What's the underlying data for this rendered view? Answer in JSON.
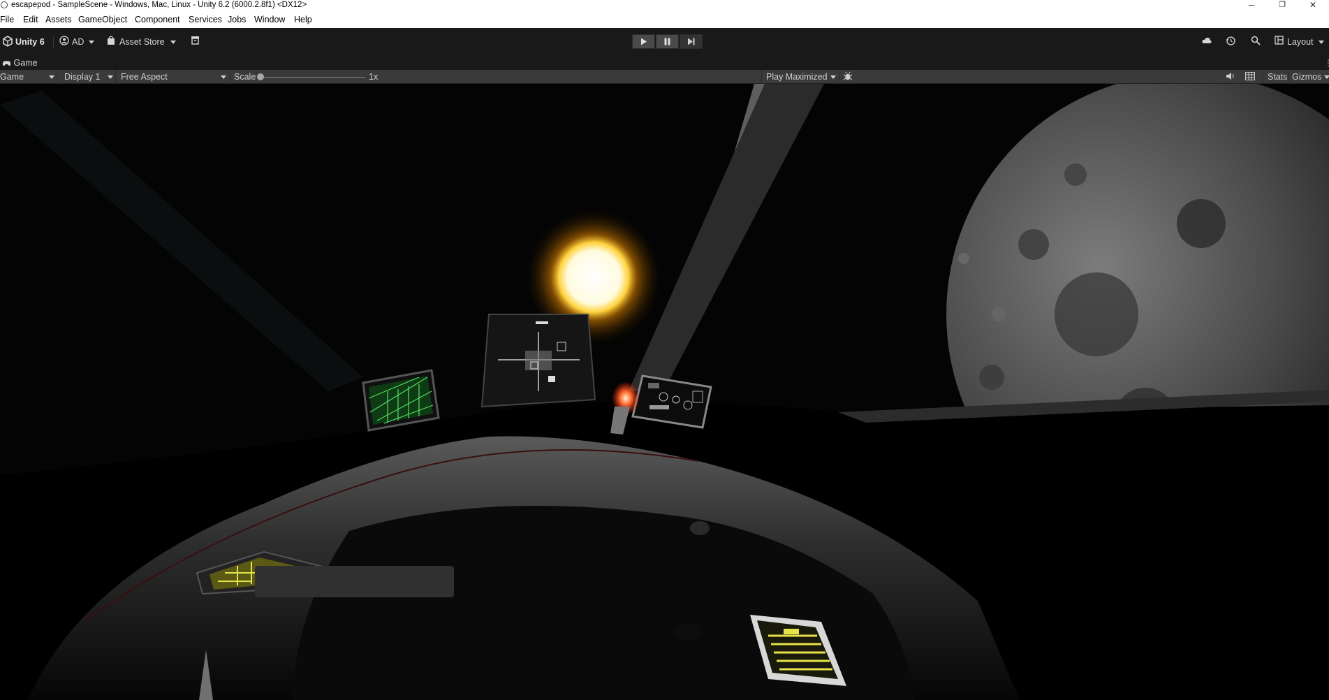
{
  "window": {
    "title": "escapepod - SampleScene - Windows, Mac, Linux - Unity 6.2 (6000.2.8f1) <DX12>",
    "controls": {
      "minimize": "─",
      "restore": "❐",
      "close": "✕"
    }
  },
  "menu": [
    "File",
    "Edit",
    "Assets",
    "GameObject",
    "Component",
    "Services",
    "Jobs",
    "Window",
    "Help"
  ],
  "toolbar": {
    "unity_label": "Unity 6",
    "account_label": "AD",
    "asset_store_label": "Asset Store",
    "layout_label": "Layout",
    "icons": [
      "unity-logo-icon",
      "account-icon",
      "asset-store-bag-icon",
      "package-icon",
      "play-icon",
      "pause-icon",
      "step-icon",
      "cloud-icon",
      "history-icon",
      "search-icon",
      "layout-icon"
    ]
  },
  "tab": {
    "label": "Game",
    "icon": "gamepad-icon"
  },
  "game_toolbar": {
    "view_mode": "Game",
    "display": "Display 1",
    "aspect": "Free Aspect",
    "scale_label": "Scale",
    "scale_value": "1x",
    "scale_fraction": 0.0,
    "play_mode": "Play Maximized",
    "stats_label": "Stats",
    "gizmos_label": "Gizmos",
    "icons": [
      "bug-icon",
      "audio-icon",
      "grid-icon",
      "more-icon"
    ]
  },
  "colors": {
    "toolbar_bg": "#191919",
    "game_toolbar_bg": "#3a3a3a",
    "sun": "#ffe27a",
    "screen_green": "#38c24a",
    "screen_yellow": "#e6e24a"
  }
}
